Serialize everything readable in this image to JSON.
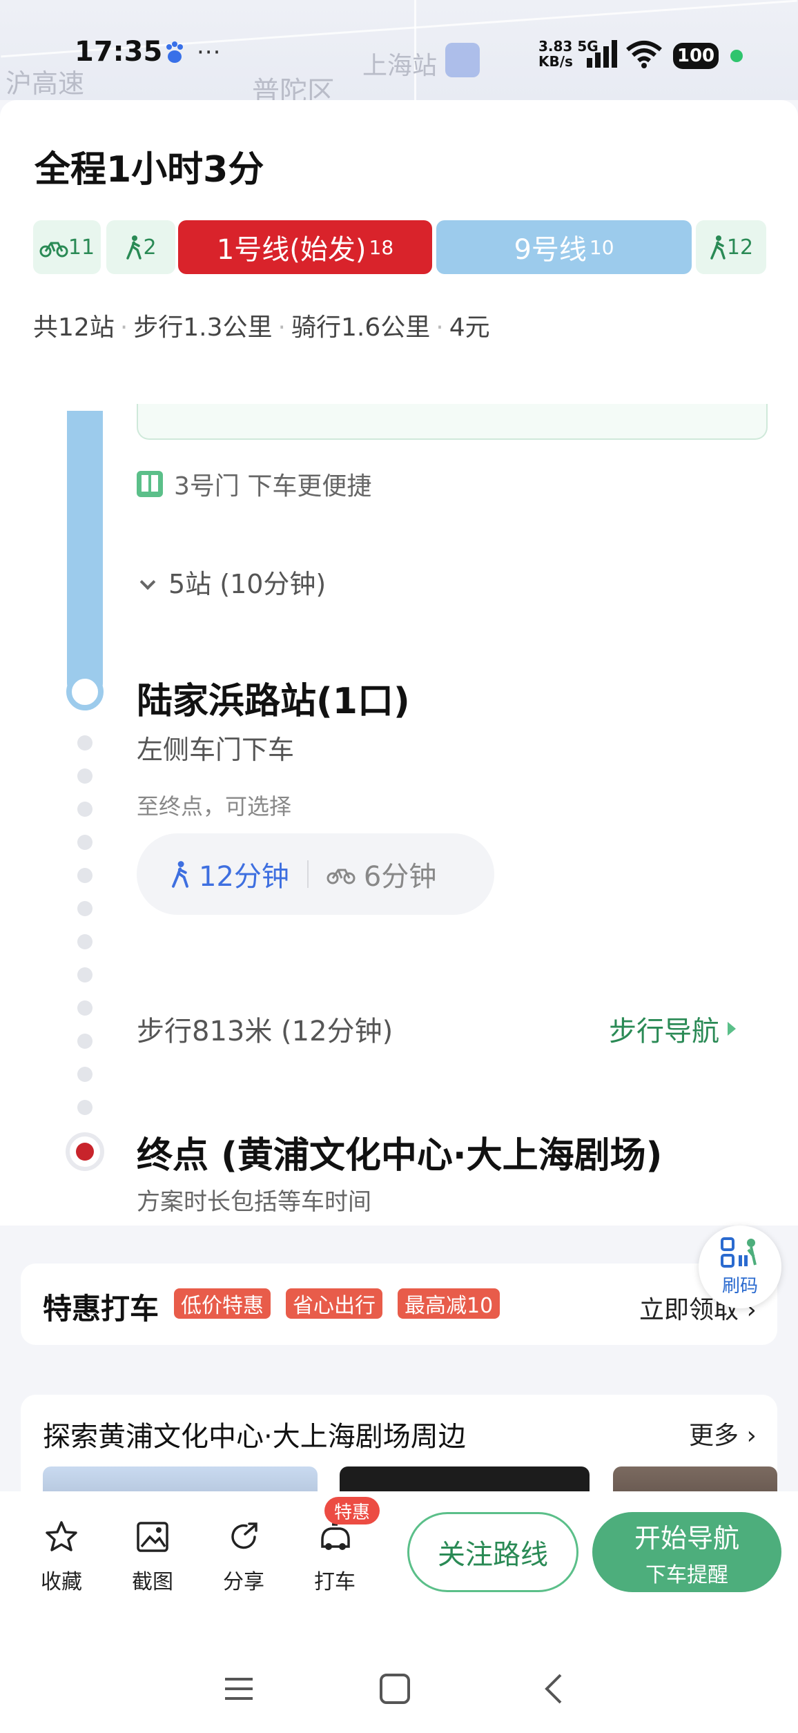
{
  "status_bar": {
    "time": "17:35",
    "more": "···",
    "net_speed_value": "3.83",
    "net_speed_unit": "KB/s",
    "network": "5G",
    "battery": "100"
  },
  "map": {
    "labels": [
      "沪高速",
      "普陀区",
      "上海站"
    ]
  },
  "summary": {
    "total_time": "全程1小时3分",
    "segments": [
      {
        "icon": "bike-icon",
        "label": "11"
      },
      {
        "icon": "walk-icon",
        "label": "2"
      },
      {
        "line": "1号线(始发)",
        "stops": "18",
        "color": "#d9232b"
      },
      {
        "line": "9号线",
        "stops": "10",
        "color": "#9ccbec"
      },
      {
        "icon": "walk-icon",
        "label": "12"
      }
    ],
    "meta": [
      "共12站",
      "步行1.3公里",
      "骑行1.6公里",
      "4元"
    ]
  },
  "detail": {
    "door_tip": "3号门 下车更便捷",
    "stops": "5站 (10分钟)",
    "station_name": "陆家浜路站(1口)",
    "door_side": "左侧车门下车",
    "to_end": "至终点，可选择",
    "walk_option": "12分钟",
    "bike_option": "6分钟",
    "walk_distance": "步行813米 (12分钟)",
    "walk_nav": "步行导航",
    "end_name": "终点 (黄浦文化中心·大上海剧场)",
    "end_note": "方案时长包括等车时间"
  },
  "qr_float": {
    "label": "刷码"
  },
  "taxi": {
    "title": "特惠打车",
    "tags": [
      "低价特惠",
      "省心出行",
      "最高减10"
    ],
    "claim": "立即领取"
  },
  "explore": {
    "title": "探索黄浦文化中心·大上海剧场周边",
    "more": "更多"
  },
  "bottom_bar": {
    "tools": [
      {
        "label": "收藏",
        "icon": "star-icon"
      },
      {
        "label": "截图",
        "icon": "image-icon"
      },
      {
        "label": "分享",
        "icon": "share-icon"
      },
      {
        "label": "打车",
        "icon": "taxi-icon"
      }
    ],
    "taxi_badge": "特惠",
    "follow_button": "关注路线",
    "start_nav": "开始导航",
    "start_nav_sub": "下车提醒"
  },
  "colors": {
    "line1": "#d9232b",
    "line9": "#9ccbec",
    "green": "#4dae7c",
    "walk_blue": "#3e6fe0",
    "tag_red": "#e85c4a"
  }
}
